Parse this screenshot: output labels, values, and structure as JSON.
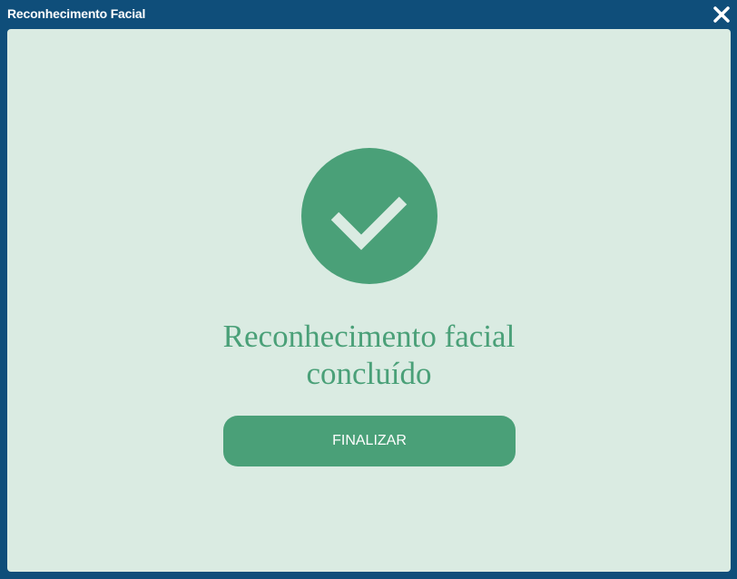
{
  "window": {
    "title": "Reconhecimento Facial",
    "close_icon": "close-icon"
  },
  "main": {
    "status_icon": "check-icon",
    "message_line1": "Reconhecimento facial",
    "message_line2": "concluído",
    "finalize_label": "FINALIZAR"
  },
  "colors": {
    "titlebar": "#0f4e7a",
    "background": "#daebe2",
    "accent": "#4aa078"
  }
}
